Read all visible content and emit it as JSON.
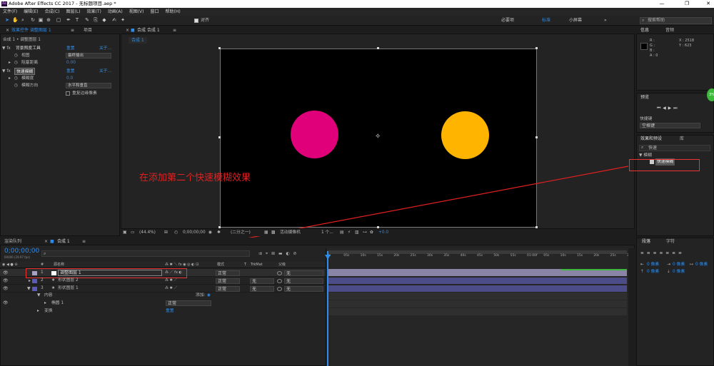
{
  "titlebar": {
    "logo": "Ae",
    "title": "Adobe After Effects CC 2017 - 无标题项目.aep *",
    "min": "—",
    "max": "❐",
    "close": "✕"
  },
  "menu": [
    "文件(F)",
    "编辑(E)",
    "合成(C)",
    "图层(L)",
    "效果(T)",
    "动画(A)",
    "视图(V)",
    "窗口",
    "帮助(H)"
  ],
  "toolbar": {
    "snap": "对齐",
    "ws_default": "必要项",
    "ws_standard": "标准",
    "ws_small": "小屏幕",
    "more": "»",
    "search_placeholder": "搜索帮助"
  },
  "effects_panel": {
    "tab_close": "×",
    "tab_active": "效果控件 调整图层 1",
    "tab_menu": "≡",
    "tab_project": "项目",
    "breadcrumb": "合成 1 • 调整图层 1",
    "effect1": {
      "name": "背景照度工具",
      "reset": "重置",
      "about": "关于..."
    },
    "view": {
      "label": "视图",
      "value": "最终输出"
    },
    "fade": {
      "label": "阻塞距离",
      "value": "0.00"
    },
    "effect2": {
      "name": "快速模糊",
      "reset": "重置",
      "about": "关于..."
    },
    "blurriness": {
      "label": "模糊度",
      "value": "0.0"
    },
    "direction": {
      "label": "模糊方向",
      "value": "水平和垂直"
    },
    "repeat_edge": {
      "label": "重复边缘像素"
    }
  },
  "comp_panel": {
    "tab_close": "×",
    "tab": "合成 合成 1",
    "tab_menu": "≡",
    "subtab": "合成 1",
    "zoom": "(44.4%)",
    "timecode": "0;00;00;00",
    "resolution": "(二分之一)",
    "camera": "活动摄像机",
    "views": "1 个...",
    "exposure": "+0.0"
  },
  "annotation": "在添加第二个快速模糊效果",
  "info_panel": {
    "tab_info": "信息",
    "tab_audio": "音频",
    "r": "R :",
    "g": "G :",
    "b": "B :",
    "a": "A : 0",
    "x": "X : 2518",
    "y": "Y : 623"
  },
  "preview_panel": {
    "title": "预览",
    "shortcut_label": "快捷键",
    "shortcut_value": "空格键",
    "badge": "3%"
  },
  "effects_presets": {
    "title": "效果和预设",
    "tab2": "库",
    "search": "快速",
    "category": "▼ 模糊",
    "item": "快速模糊"
  },
  "timeline": {
    "tab_render": "渲染队列",
    "tab_comp": "合成 1",
    "tab_menu": "≡",
    "timecode": "0;00;00;00",
    "fps": "00000 (29.97 fps)",
    "col_num": "#",
    "col_name": "源名称",
    "col_mode": "模式",
    "col_t": "T",
    "col_trkmat": "TrkMat",
    "col_parent": "父级",
    "ruler": [
      "0s",
      "05s",
      "10s",
      "15s",
      "20s",
      "25s",
      "30s",
      "35s",
      "40s",
      "45s",
      "50s",
      "55s",
      "01:00f",
      "05s",
      "10s",
      "15s",
      "20s",
      "25s",
      "30s"
    ],
    "layers": [
      {
        "num": "1",
        "name": "调整图层 1",
        "mode": "正常",
        "trkmat": "",
        "parent": "无",
        "color": "#a8a0c8"
      },
      {
        "num": "2",
        "name": "形状图层 2",
        "mode": "正常",
        "trkmat": "无",
        "parent": "无",
        "color": "#5a5ab8"
      },
      {
        "num": "3",
        "name": "形状图层 1",
        "mode": "正常",
        "trkmat": "无",
        "parent": "无",
        "color": "#5a5ab8"
      }
    ],
    "contents": "内容",
    "add": "添加:",
    "ellipse": "椭圆 1",
    "ellipse_mode": "正常",
    "transform": "变换",
    "transform_reset": "重置"
  },
  "paragraph_panel": {
    "tab_para": "段落",
    "tab_char": "字符",
    "px0": "0 像素",
    "px1": "0 像素",
    "px2": "0 像素",
    "px3": "0 像素",
    "px4": "0 像素"
  },
  "colors": {
    "accent": "#2d8ceb",
    "magenta": "#e0007a",
    "orange": "#ffb400",
    "annotation": "#e02020"
  }
}
